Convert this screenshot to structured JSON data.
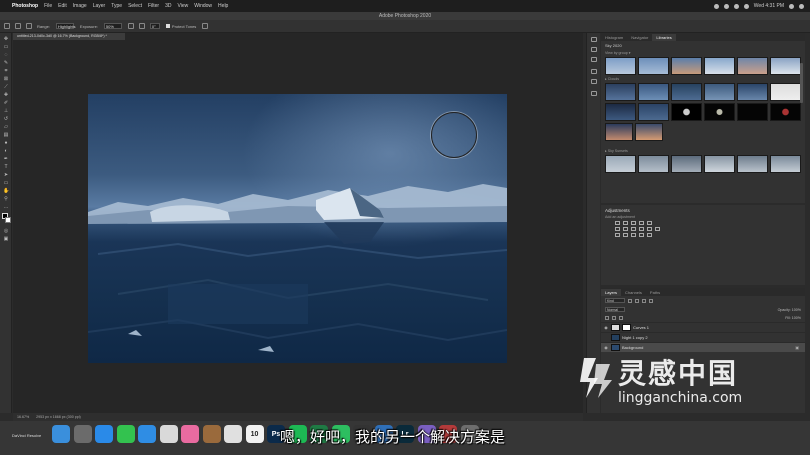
{
  "menubar": {
    "app_name": "Photoshop",
    "items": [
      "File",
      "Edit",
      "Image",
      "Layer",
      "Type",
      "Select",
      "Filter",
      "3D",
      "View",
      "Window",
      "Help"
    ],
    "clock": "Wed 4:31 PM"
  },
  "window": {
    "title": "Adobe Photoshop 2020"
  },
  "options_bar": {
    "range_label": "Range:",
    "range_value": "Highlights",
    "exposure_label": "Exposure:",
    "exposure_value": "50%",
    "angle_value": "0°",
    "protect_tones_label": "Protect Tones"
  },
  "document": {
    "tab_title": "untitled-213-0d0c-3d0 @ 16.7% (Background, RGB/8*) *",
    "status_text": "16.67%       2953 px x 1668 px (300 ppi)"
  },
  "panels": {
    "top_tabs": [
      "Histogram",
      "Navigator",
      "Libraries"
    ],
    "active_top_tab": "Libraries",
    "library_name": "Sky 2020",
    "view_by": "View by group ▾",
    "group1": "▸ Clouds",
    "group2": "▸ Night",
    "group3": "▸ Sky Sunsets",
    "adjustments_title": "Adjustments",
    "adjustments_sub": "Add an adjustment",
    "layers_tabs": [
      "Layers",
      "Channels",
      "Paths"
    ],
    "layers_kind": "Kind",
    "layers_mode": "Normal",
    "layers_opacity": "Opacity: 100%",
    "layers_fill": "Fill: 100%",
    "layers": [
      {
        "name": "Curves 1"
      },
      {
        "name": "Night 1 copy 2"
      },
      {
        "name": "Background"
      }
    ]
  },
  "dock": {
    "left_label": "DaVinci Resolve",
    "apps": [
      {
        "label": "",
        "icon": "finder-icon",
        "color": "#3a8fdc"
      },
      {
        "label": "",
        "icon": "launchpad-icon",
        "color": "#6b6b6b"
      },
      {
        "label": "",
        "icon": "safari-icon",
        "color": "#2a8ae8"
      },
      {
        "label": "",
        "icon": "messages-icon",
        "color": "#33c24f"
      },
      {
        "label": "",
        "icon": "chat-icon",
        "color": "#2f8de4"
      },
      {
        "label": "",
        "icon": "chrome-icon",
        "color": "#d9d9d9"
      },
      {
        "label": "",
        "icon": "photos-icon",
        "color": "#e96ba0"
      },
      {
        "label": "",
        "icon": "notes-icon",
        "color": "#9a6a3c"
      },
      {
        "label": "",
        "icon": "reminders-icon",
        "color": "#e0e0e0"
      },
      {
        "label": "10",
        "icon": "calendar-icon",
        "color": "#f2f2f2"
      },
      {
        "label": "Ps",
        "icon": "photoshop-icon",
        "color": "#0b2a4a"
      },
      {
        "label": "",
        "icon": "spotify-icon",
        "color": "#1db954"
      },
      {
        "label": "X",
        "icon": "excel-icon",
        "color": "#1f7a44"
      },
      {
        "label": "",
        "icon": "evernote-icon",
        "color": "#2dbe60"
      },
      {
        "label": "",
        "icon": "davinci-icon",
        "color": "#333"
      },
      {
        "label": "",
        "icon": "browser-icon",
        "color": "#2f6fb7"
      },
      {
        "label": "Lr",
        "icon": "lightroom-icon",
        "color": "#0a2a3a"
      },
      {
        "label": "",
        "icon": "app-icon",
        "color": "#7a5fc0"
      },
      {
        "label": "",
        "icon": "photo-booth-icon",
        "color": "#b33a3a"
      },
      {
        "label": "",
        "icon": "trash-icon",
        "color": "#6d6d6d"
      }
    ]
  },
  "subtitle": "嗯，好吧，我的另一个解决方案是",
  "watermark": {
    "cn": "灵感中国",
    "en": "lingganchina.com"
  }
}
